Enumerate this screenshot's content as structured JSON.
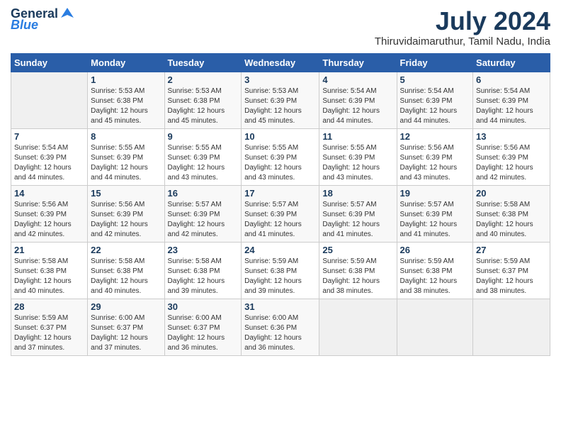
{
  "header": {
    "logo_line1": "General",
    "logo_line2": "Blue",
    "month_year": "July 2024",
    "location": "Thiruvidaimaruthur, Tamil Nadu, India"
  },
  "calendar": {
    "headers": [
      "Sunday",
      "Monday",
      "Tuesday",
      "Wednesday",
      "Thursday",
      "Friday",
      "Saturday"
    ],
    "weeks": [
      [
        {
          "day": "",
          "info": ""
        },
        {
          "day": "1",
          "info": "Sunrise: 5:53 AM\nSunset: 6:38 PM\nDaylight: 12 hours\nand 45 minutes."
        },
        {
          "day": "2",
          "info": "Sunrise: 5:53 AM\nSunset: 6:38 PM\nDaylight: 12 hours\nand 45 minutes."
        },
        {
          "day": "3",
          "info": "Sunrise: 5:53 AM\nSunset: 6:39 PM\nDaylight: 12 hours\nand 45 minutes."
        },
        {
          "day": "4",
          "info": "Sunrise: 5:54 AM\nSunset: 6:39 PM\nDaylight: 12 hours\nand 44 minutes."
        },
        {
          "day": "5",
          "info": "Sunrise: 5:54 AM\nSunset: 6:39 PM\nDaylight: 12 hours\nand 44 minutes."
        },
        {
          "day": "6",
          "info": "Sunrise: 5:54 AM\nSunset: 6:39 PM\nDaylight: 12 hours\nand 44 minutes."
        }
      ],
      [
        {
          "day": "7",
          "info": "Sunrise: 5:54 AM\nSunset: 6:39 PM\nDaylight: 12 hours\nand 44 minutes."
        },
        {
          "day": "8",
          "info": "Sunrise: 5:55 AM\nSunset: 6:39 PM\nDaylight: 12 hours\nand 44 minutes."
        },
        {
          "day": "9",
          "info": "Sunrise: 5:55 AM\nSunset: 6:39 PM\nDaylight: 12 hours\nand 43 minutes."
        },
        {
          "day": "10",
          "info": "Sunrise: 5:55 AM\nSunset: 6:39 PM\nDaylight: 12 hours\nand 43 minutes."
        },
        {
          "day": "11",
          "info": "Sunrise: 5:55 AM\nSunset: 6:39 PM\nDaylight: 12 hours\nand 43 minutes."
        },
        {
          "day": "12",
          "info": "Sunrise: 5:56 AM\nSunset: 6:39 PM\nDaylight: 12 hours\nand 43 minutes."
        },
        {
          "day": "13",
          "info": "Sunrise: 5:56 AM\nSunset: 6:39 PM\nDaylight: 12 hours\nand 42 minutes."
        }
      ],
      [
        {
          "day": "14",
          "info": "Sunrise: 5:56 AM\nSunset: 6:39 PM\nDaylight: 12 hours\nand 42 minutes."
        },
        {
          "day": "15",
          "info": "Sunrise: 5:56 AM\nSunset: 6:39 PM\nDaylight: 12 hours\nand 42 minutes."
        },
        {
          "day": "16",
          "info": "Sunrise: 5:57 AM\nSunset: 6:39 PM\nDaylight: 12 hours\nand 42 minutes."
        },
        {
          "day": "17",
          "info": "Sunrise: 5:57 AM\nSunset: 6:39 PM\nDaylight: 12 hours\nand 41 minutes."
        },
        {
          "day": "18",
          "info": "Sunrise: 5:57 AM\nSunset: 6:39 PM\nDaylight: 12 hours\nand 41 minutes."
        },
        {
          "day": "19",
          "info": "Sunrise: 5:57 AM\nSunset: 6:39 PM\nDaylight: 12 hours\nand 41 minutes."
        },
        {
          "day": "20",
          "info": "Sunrise: 5:58 AM\nSunset: 6:38 PM\nDaylight: 12 hours\nand 40 minutes."
        }
      ],
      [
        {
          "day": "21",
          "info": "Sunrise: 5:58 AM\nSunset: 6:38 PM\nDaylight: 12 hours\nand 40 minutes."
        },
        {
          "day": "22",
          "info": "Sunrise: 5:58 AM\nSunset: 6:38 PM\nDaylight: 12 hours\nand 40 minutes."
        },
        {
          "day": "23",
          "info": "Sunrise: 5:58 AM\nSunset: 6:38 PM\nDaylight: 12 hours\nand 39 minutes."
        },
        {
          "day": "24",
          "info": "Sunrise: 5:59 AM\nSunset: 6:38 PM\nDaylight: 12 hours\nand 39 minutes."
        },
        {
          "day": "25",
          "info": "Sunrise: 5:59 AM\nSunset: 6:38 PM\nDaylight: 12 hours\nand 38 minutes."
        },
        {
          "day": "26",
          "info": "Sunrise: 5:59 AM\nSunset: 6:38 PM\nDaylight: 12 hours\nand 38 minutes."
        },
        {
          "day": "27",
          "info": "Sunrise: 5:59 AM\nSunset: 6:37 PM\nDaylight: 12 hours\nand 38 minutes."
        }
      ],
      [
        {
          "day": "28",
          "info": "Sunrise: 5:59 AM\nSunset: 6:37 PM\nDaylight: 12 hours\nand 37 minutes."
        },
        {
          "day": "29",
          "info": "Sunrise: 6:00 AM\nSunset: 6:37 PM\nDaylight: 12 hours\nand 37 minutes."
        },
        {
          "day": "30",
          "info": "Sunrise: 6:00 AM\nSunset: 6:37 PM\nDaylight: 12 hours\nand 36 minutes."
        },
        {
          "day": "31",
          "info": "Sunrise: 6:00 AM\nSunset: 6:36 PM\nDaylight: 12 hours\nand 36 minutes."
        },
        {
          "day": "",
          "info": ""
        },
        {
          "day": "",
          "info": ""
        },
        {
          "day": "",
          "info": ""
        }
      ]
    ]
  }
}
